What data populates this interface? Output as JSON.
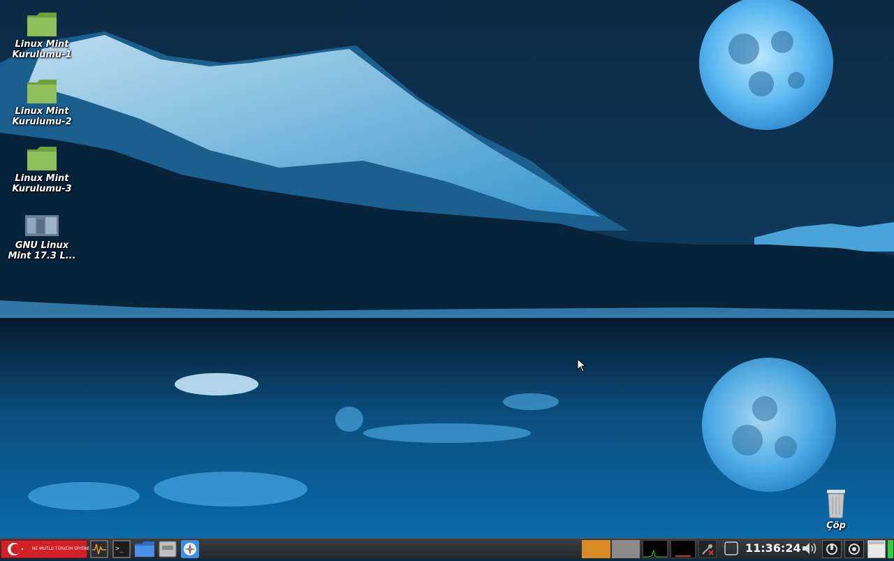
{
  "desktop": {
    "icons": [
      {
        "label": "Linux Mint Kurulumu-1",
        "icon": "folder-icon"
      },
      {
        "label": "Linux Mint Kurulumu-2",
        "icon": "folder-icon"
      },
      {
        "label": "Linux Mint Kurulumu-3",
        "icon": "folder-icon"
      },
      {
        "label": "GNU Linux Mint 17.3 L...",
        "icon": "image-file-icon"
      }
    ],
    "trash": {
      "label": "Çöp",
      "icon": "trash-icon"
    }
  },
  "taskbar": {
    "menu_button": {
      "text_a": "NE MUTLU",
      "text_b": "TÜRKÜM",
      "text_c": "DİYENE",
      "icon": "turkish-flag-icon"
    },
    "launchers": [
      "system-monitor-icon",
      "terminal-icon",
      "file-manager-icon",
      "disk-icon",
      "web-browser-icon"
    ],
    "workspaces": [
      {
        "active": true,
        "color": "#d98a24"
      },
      {
        "active": false,
        "color": "#8a8a8a"
      }
    ],
    "clock": "11:36:24",
    "tray": [
      "cpu-graph-icon",
      "network-graph-icon",
      "network-disconnected-icon",
      "notification-icon",
      "volume-icon",
      "power-icon",
      "update-icon",
      "show-desktop-icon",
      "battery-icon"
    ]
  },
  "colors": {
    "taskbar": "#2e3135",
    "accent": "#d98a24",
    "folder": "#8fbf5a"
  }
}
